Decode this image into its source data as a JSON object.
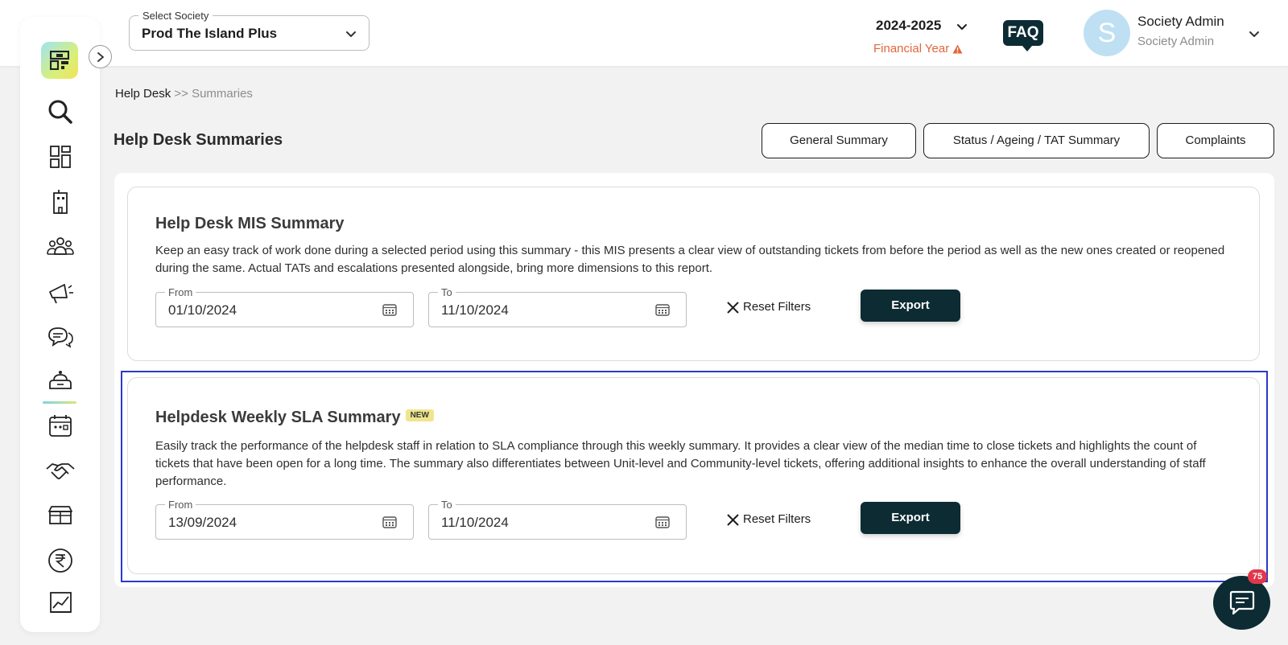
{
  "header": {
    "society": {
      "legend": "Select Society",
      "value": "Prod The Island Plus"
    },
    "financial_year": {
      "year": "2024-2025",
      "label": "Financial Year"
    },
    "faq_label": "FAQ",
    "user": {
      "initial": "S",
      "name": "Society Admin",
      "role": "Society Admin"
    }
  },
  "sidebar": {
    "items": [
      "search-icon",
      "dashboard-icon",
      "building-icon",
      "community-icon",
      "announcement-icon",
      "chat-icon",
      "helpdesk-icon",
      "calendar-icon",
      "handshake-icon",
      "store-icon",
      "rupee-icon",
      "reports-icon"
    ],
    "active": "helpdesk-icon"
  },
  "breadcrumb": {
    "root": "Help Desk",
    "separator": ">>",
    "current": "Summaries"
  },
  "page": {
    "title": "Help Desk Summaries",
    "tabs": [
      "General Summary",
      "Status / Ageing / TAT Summary",
      "Complaints"
    ]
  },
  "cards": [
    {
      "title": "Help Desk MIS Summary",
      "description": "Keep an easy track of work done during a selected period using this summary - this MIS presents a clear view of outstanding tickets from before the period as well as the new ones created or reopened during the same. Actual TATs and escalations presented alongside, bring more dimensions to this report.",
      "from_label": "From",
      "from": "01/10/2024",
      "to_label": "To",
      "to": "11/10/2024",
      "reset_label": "Reset Filters",
      "export_label": "Export"
    },
    {
      "title": "Helpdesk Weekly SLA Summary",
      "badge": "NEW",
      "description": "Easily track the performance of the helpdesk staff in relation to SLA compliance through this weekly summary. It provides a clear view of the median time to close tickets and highlights the count of tickets that have been open for a long time. The summary also differentiates between Unit-level and Community-level tickets, offering additional insights to enhance the overall understanding of staff performance.",
      "from_label": "From",
      "from": "13/09/2024",
      "to_label": "To",
      "to": "11/10/2024",
      "reset_label": "Reset Filters",
      "export_label": "Export"
    }
  ],
  "chat": {
    "badge_count": "75"
  },
  "colors": {
    "primary": "#0d2b33",
    "accent_warning": "#e2663b",
    "highlight": "#2b39c9",
    "badge_new": "#f1e58c"
  }
}
